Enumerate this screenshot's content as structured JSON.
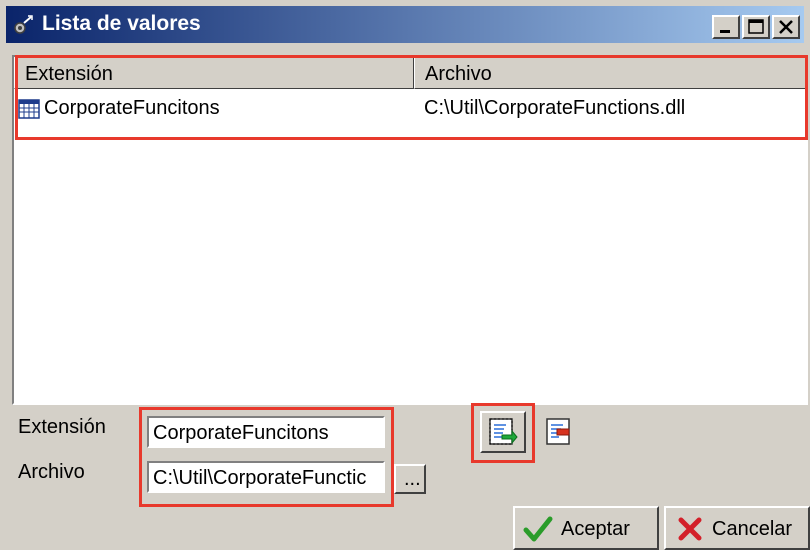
{
  "window": {
    "title": "Lista de valores",
    "controls": [
      "minimize",
      "maximize",
      "close"
    ]
  },
  "list": {
    "columns": [
      "Extensión",
      "Archivo"
    ],
    "rows": [
      {
        "icon": "table-icon",
        "extension": "CorporateFuncitons",
        "file": "C:\\Util\\CorporateFunctions.dll"
      }
    ]
  },
  "form": {
    "extension_label": "Extensión",
    "extension_value": "CorporateFuncitons",
    "file_label": "Archivo",
    "file_value": "C:\\Util\\CorporateFunctic",
    "browse_label": "..."
  },
  "actions": {
    "ok_label": "Aceptar",
    "cancel_label": "Cancelar"
  },
  "colors": {
    "highlight": "#e8392c",
    "titlebar": "#0a246a",
    "background": "#d4d0c8"
  }
}
